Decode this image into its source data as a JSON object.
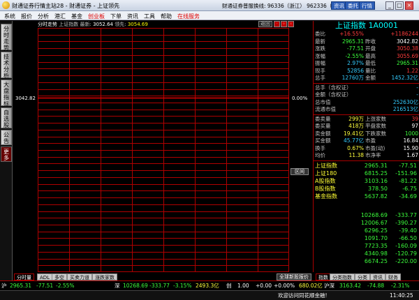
{
  "titlebar": {
    "title": "财通证券行情主站28 - 财通证券 - 上证领先",
    "status": "财通证券普服换线: 96336（浙江） 962336（上海）",
    "btn_a": "资讯",
    "btn_b": "委托",
    "btn_c": "行情"
  },
  "menu": [
    "系统",
    "报价",
    "分析",
    "港汇",
    "基金",
    "创业板",
    "下单",
    "资讯",
    "工具",
    "帮助",
    "在线服务"
  ],
  "leftbar": [
    "分时走势",
    "技术分析",
    "大盘指标",
    "自选股",
    "公告",
    "更多"
  ],
  "chart": {
    "header_label": "分时走势",
    "index_name": "上证指数",
    "latest_label": "最新:",
    "latest_value": "3052.64",
    "lead_label": "领先:",
    "lead_value": "3054.69",
    "left_axis_value": "3042.82",
    "right_axis_value": "0.00%",
    "btn_back": "返回",
    "zone_btn": "区间"
  },
  "right": {
    "title": "上证指数 1A0001",
    "rows": [
      {
        "k": "委比",
        "v1": "+16.55%",
        "k2": "",
        "v2": "+1186244",
        "c1": "red",
        "c2": "red"
      },
      {
        "k": "最新",
        "v1": "2965.31",
        "k2": "昨收",
        "v2": "3042.82",
        "c1": "green",
        "c2": "white"
      },
      {
        "k": "涨跌",
        "v1": "-77.51",
        "k2": "开盘",
        "v2": "3050.38",
        "c1": "green",
        "c2": "red"
      },
      {
        "k": "涨幅",
        "v1": "-2.55%",
        "k2": "最高",
        "v2": "3055.69",
        "c1": "green",
        "c2": "red"
      },
      {
        "k": "振幅",
        "v1": "2.97%",
        "k2": "最低",
        "v2": "2965.31",
        "c1": "cyan",
        "c2": "green"
      },
      {
        "k": "现手",
        "v1": "52856",
        "k2": "量比",
        "v2": "1.22",
        "c1": "cyan",
        "c2": "red"
      },
      {
        "k": "总手",
        "v1": "12760万",
        "k2": "金额",
        "v2": "1452.32亿",
        "c1": "cyan",
        "c2": "cyan"
      }
    ],
    "mid": [
      {
        "k": "总手（含权证）",
        "v": "-"
      },
      {
        "k": "金额（含权证）",
        "v": "-"
      },
      {
        "k": "总市值",
        "v": "252630亿"
      },
      {
        "k": "流通市值",
        "v": "216513亿"
      }
    ],
    "stats": [
      {
        "k": "委卖量",
        "v1": "299万",
        "k2": "上涨家数",
        "v2": "39",
        "c1": "yellow",
        "c2": "red"
      },
      {
        "k": "委买量",
        "v1": "418万",
        "k2": "平盘家数",
        "v2": "97",
        "c1": "yellow",
        "c2": "white"
      },
      {
        "k": "卖金额",
        "v1": "19.41亿",
        "k2": "下跌家数",
        "v2": "1000",
        "c1": "yellow",
        "c2": "green"
      },
      {
        "k": "买金额",
        "v1": "45.77亿",
        "k2": "市盈",
        "v2": "16.84",
        "c1": "cyan",
        "c2": "white"
      },
      {
        "k": "换手",
        "v1": "0.67%",
        "k2": "市盈(动)",
        "v2": "15.90",
        "c1": "yellow",
        "c2": "white"
      },
      {
        "k": "均价",
        "v1": "11.38",
        "k2": "市净率",
        "v2": "1.67",
        "c1": "yellow",
        "c2": "white"
      }
    ],
    "indices": [
      {
        "k": "上证指数",
        "v1": "2965.31",
        "v2": "-77.51"
      },
      {
        "k": "上证180",
        "v1": "6815.25",
        "v2": "-151.96"
      },
      {
        "k": "A股指数",
        "v1": "3103.16",
        "v2": "-81.22"
      },
      {
        "k": "B股指数",
        "v1": "378.50",
        "v2": "-6.75"
      },
      {
        "k": "基金指数",
        "v1": "5637.82",
        "v2": "-34.69"
      }
    ],
    "others": [
      {
        "v1": "10268.69",
        "v2": "-333.77"
      },
      {
        "v1": "12006.67",
        "v2": "-390.27"
      },
      {
        "v1": "6296.25",
        "v2": "-39.40"
      },
      {
        "v1": "1091.70",
        "v2": "-66.50"
      },
      {
        "v1": "7723.35",
        "v2": "-160.09"
      },
      {
        "v1": "4340.98",
        "v2": "-120.79"
      },
      {
        "v1": "6674.25",
        "v2": "-220.00"
      }
    ]
  },
  "bottom_tabs": [
    "分时量",
    "ADL",
    "多空",
    "买卖力道",
    "涨跌家数"
  ],
  "quote_btn": "全球新股报价",
  "right_tabs": [
    "指数",
    "分类指数",
    "分类",
    "资讯",
    "财务"
  ],
  "statusbar": {
    "sh_label": "沪",
    "sh_value": "2965.31",
    "sh_change": "-77.51",
    "sh_pct": "-2.55%",
    "sz_label": "深",
    "sz_value": "10268.69",
    "sz_change": "-333.77",
    "sz_pct": "-3.15%",
    "sz_amount": "2493.3亿",
    "mid_tag": "创",
    "mid_a": "1.00",
    "mid_b": "+0.00",
    "mid_pct": "+0.00%",
    "mid_amount": "680.02亿",
    "hs_label": "沪深",
    "hs_value": "3163.42",
    "hs_change": "-74.88",
    "hs_pct": "-2.31%"
  },
  "footer": {
    "welcome": "欢迎访问同花顺金融!",
    "time": "11:40:25"
  }
}
